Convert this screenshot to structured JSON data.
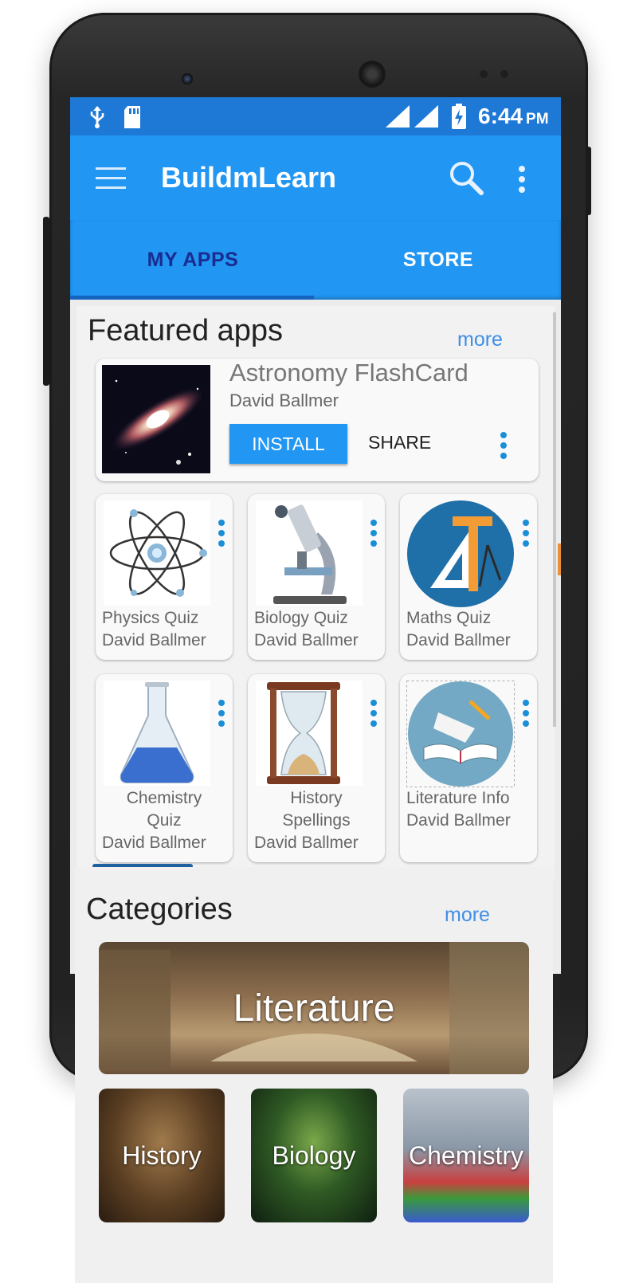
{
  "status_bar": {
    "time": "6:44",
    "ampm": "PM"
  },
  "app_bar": {
    "title": "BuildmLearn"
  },
  "tabs": [
    {
      "label": "MY APPS"
    },
    {
      "label": "STORE"
    }
  ],
  "featured": {
    "title": "Featured apps",
    "more": "more",
    "hero": {
      "title": "Astronomy FlashCard",
      "author": "David Ballmer",
      "install_label": "INSTALL",
      "share_label": "SHARE"
    },
    "apps": [
      {
        "name": "Physics Quiz",
        "author": "David Ballmer"
      },
      {
        "name": "Biology Quiz",
        "author": "David Ballmer"
      },
      {
        "name": "Maths Quiz",
        "author": "David Ballmer"
      },
      {
        "name_line1": "Chemistry",
        "name_line2": "Quiz",
        "author": "David Ballmer"
      },
      {
        "name_line1": "History",
        "name_line2": "Spellings",
        "author": "David Ballmer"
      },
      {
        "name": "Literature Info",
        "author": "David Ballmer"
      }
    ]
  },
  "categories": {
    "title": "Categories",
    "more": "more",
    "items": [
      {
        "label": "Literature"
      },
      {
        "label": "History"
      },
      {
        "label": "Biology"
      },
      {
        "label": "Chemistry"
      }
    ]
  },
  "colors": {
    "primary": "#2196f3",
    "status": "#1e78d6",
    "accent_dots": "#1a8fd8",
    "active_tab": "#1a2c8f"
  }
}
